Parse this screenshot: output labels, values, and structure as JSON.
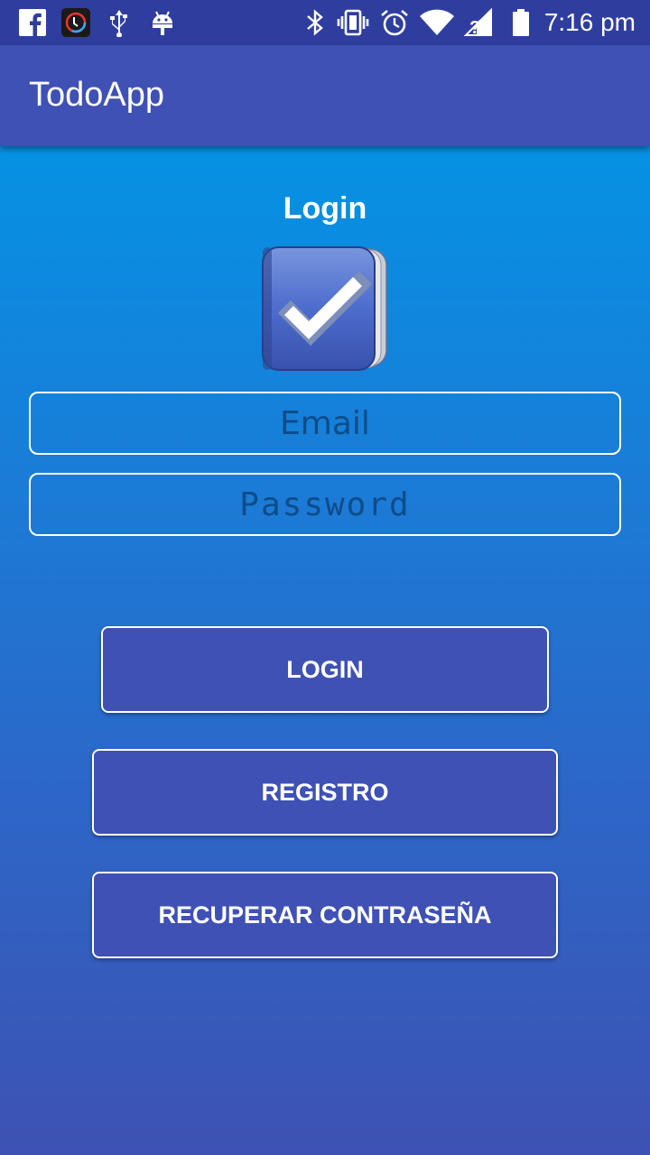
{
  "status_bar": {
    "time": "7:16 pm",
    "left_icons": [
      "facebook-icon",
      "app-icon",
      "usb-icon",
      "android-icon"
    ],
    "right_icons": [
      "bluetooth-icon",
      "vibrate-icon",
      "alarm-icon",
      "wifi-icon",
      "signal-icon",
      "battery-icon"
    ]
  },
  "app_bar": {
    "title": "TodoApp"
  },
  "login_form": {
    "heading": "Login",
    "logo_icon": "checkmark-book-icon",
    "email_placeholder": "Email",
    "password_placeholder": "Password",
    "login_button": "LOGIN",
    "register_button": "REGISTRO",
    "recover_button": "RECUPERAR CONTRASEÑA"
  },
  "colors": {
    "primary": "#3f51b5",
    "primary_dark": "#2f3e9e",
    "gradient_top": "#0592e4",
    "gradient_bottom": "#3d52b3",
    "field_text": "#0d4c8a"
  }
}
